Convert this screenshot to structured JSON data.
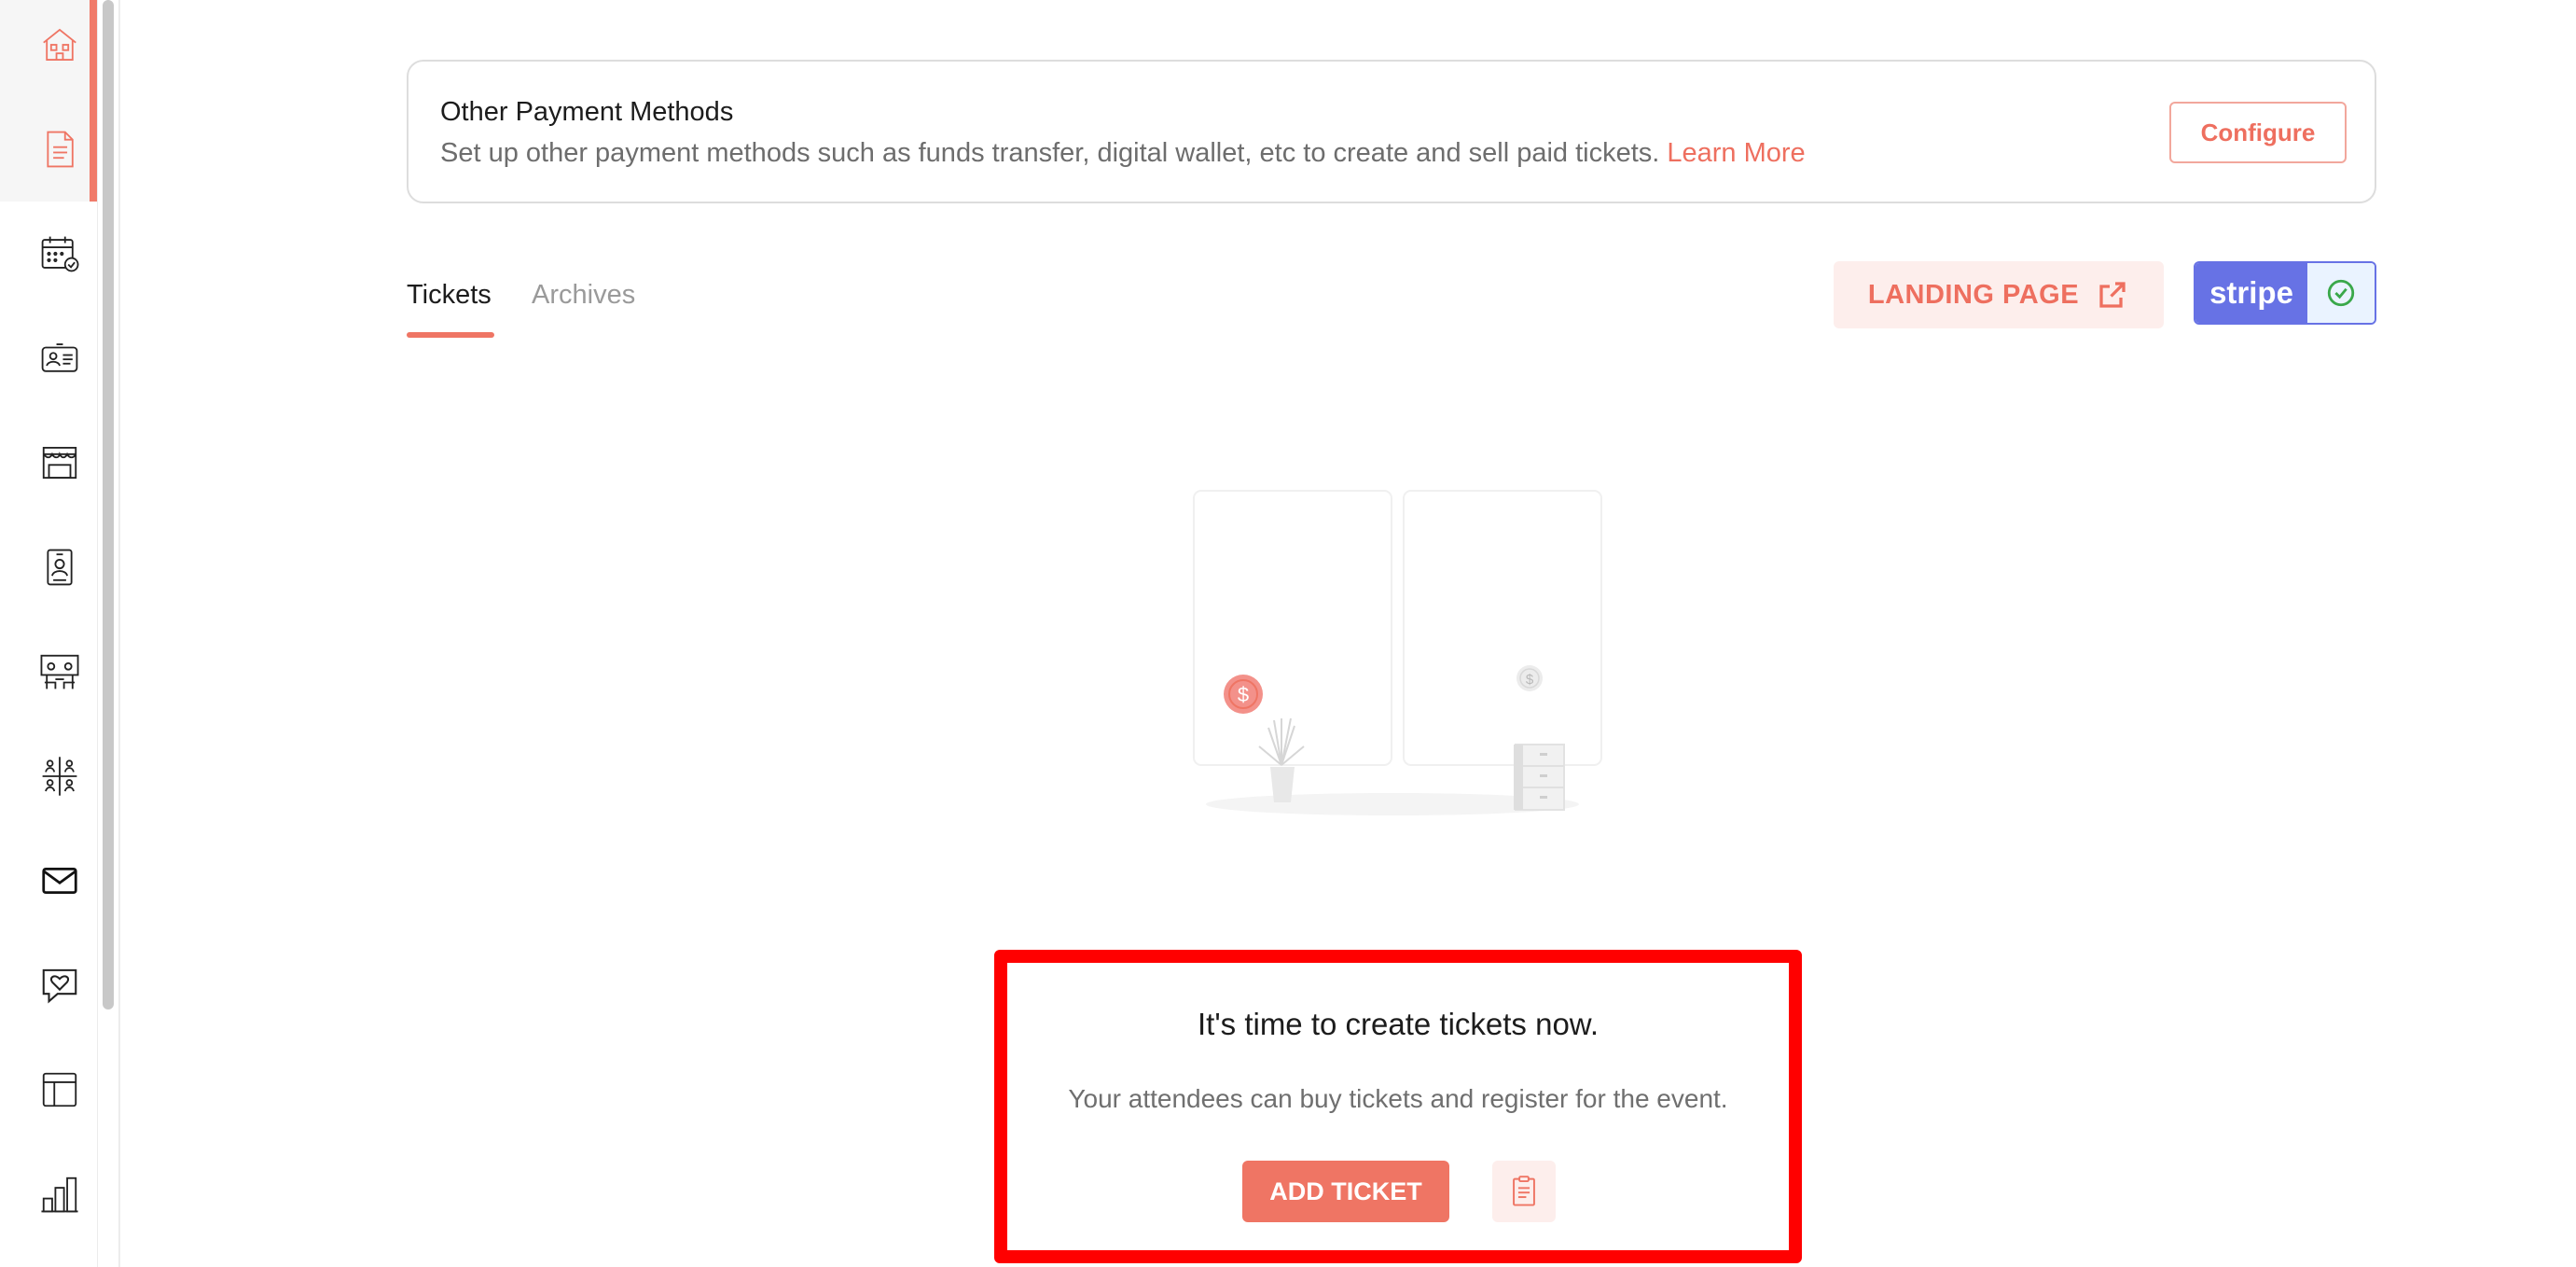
{
  "sidebar": {
    "items": [
      {
        "icon": "home-icon"
      },
      {
        "icon": "document-icon"
      },
      {
        "icon": "calendar-check-icon"
      },
      {
        "icon": "id-card-icon"
      },
      {
        "icon": "booth-icon"
      },
      {
        "icon": "badge-icon"
      },
      {
        "icon": "stage-icon"
      },
      {
        "icon": "networking-icon"
      },
      {
        "icon": "mail-icon"
      },
      {
        "icon": "chat-heart-icon"
      },
      {
        "icon": "layout-icon"
      },
      {
        "icon": "bar-chart-icon"
      }
    ]
  },
  "payment": {
    "title": "Other Payment Methods",
    "description": "Set up other payment methods such as funds transfer, digital wallet, etc to create and sell paid tickets.",
    "learn_more": "Learn More",
    "configure_label": "Configure"
  },
  "tabs": [
    {
      "label": "Tickets",
      "active": true
    },
    {
      "label": "Archives",
      "active": false
    }
  ],
  "toolbar": {
    "landing_page_label": "LANDING PAGE",
    "stripe_label": "stripe",
    "stripe_connected": true
  },
  "empty_state": {
    "title": "It's time to create tickets now.",
    "description": "Your attendees can buy tickets and register for the event.",
    "add_ticket_label": "ADD TICKET"
  },
  "colors": {
    "accent": "#ef7564",
    "stripe": "#6772e5",
    "highlight": "#ff0000"
  }
}
